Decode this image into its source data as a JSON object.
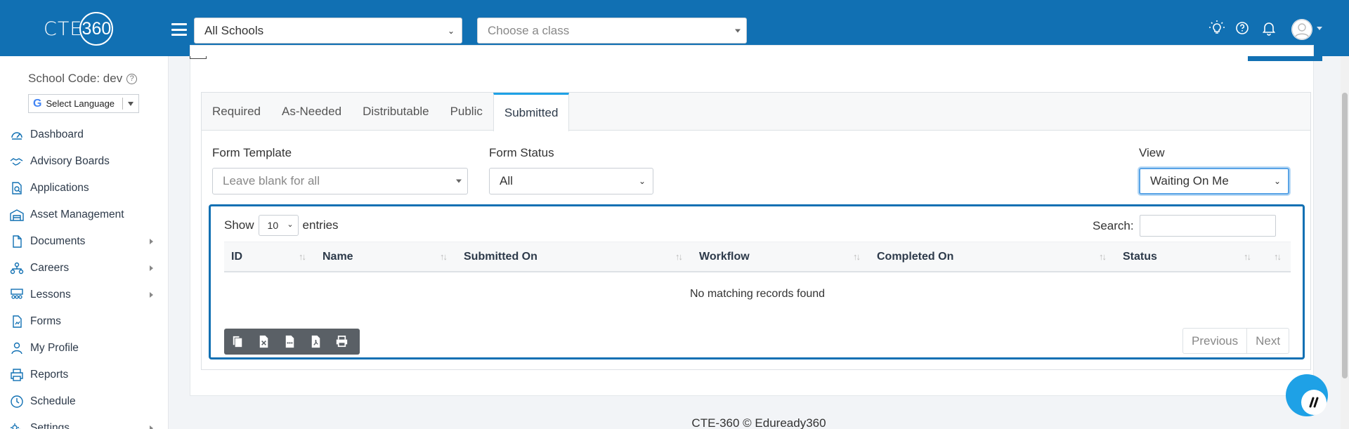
{
  "header": {
    "logo_text": "CTE",
    "logo_number": "360",
    "school_select": "All Schools",
    "class_select_placeholder": "Choose a class",
    "icons": [
      "lightbulb-icon",
      "help-circle-icon",
      "bell-icon",
      "user-avatar-icon"
    ]
  },
  "sidebar": {
    "school_code": "School Code: dev",
    "language_label": "Select Language",
    "items": [
      {
        "label": "Dashboard",
        "icon": "dashboard-icon",
        "submenu": false
      },
      {
        "label": "Advisory Boards",
        "icon": "handshake-icon",
        "submenu": false
      },
      {
        "label": "Applications",
        "icon": "document-search-icon",
        "submenu": false
      },
      {
        "label": "Asset Management",
        "icon": "warehouse-icon",
        "submenu": false
      },
      {
        "label": "Documents",
        "icon": "file-icon",
        "submenu": true
      },
      {
        "label": "Careers",
        "icon": "org-chart-icon",
        "submenu": true
      },
      {
        "label": "Lessons",
        "icon": "classroom-icon",
        "submenu": true
      },
      {
        "label": "Forms",
        "icon": "form-icon",
        "submenu": false
      },
      {
        "label": "My Profile",
        "icon": "user-icon",
        "submenu": false
      },
      {
        "label": "Reports",
        "icon": "printer-icon",
        "submenu": false
      },
      {
        "label": "Schedule",
        "icon": "clock-icon",
        "submenu": false
      },
      {
        "label": "Settings",
        "icon": "settings-icon",
        "submenu": true
      }
    ]
  },
  "tabs": [
    {
      "label": "Required",
      "active": false
    },
    {
      "label": "As-Needed",
      "active": false
    },
    {
      "label": "Distributable",
      "active": false
    },
    {
      "label": "Public",
      "active": false
    },
    {
      "label": "Submitted",
      "active": true
    }
  ],
  "filters": {
    "form_template_label": "Form Template",
    "form_template_placeholder": "Leave blank for all",
    "form_status_label": "Form Status",
    "form_status_value": "All",
    "view_label": "View",
    "view_value": "Waiting On Me"
  },
  "table": {
    "show_label": "Show",
    "entries_value": "10",
    "entries_label": "entries",
    "search_label": "Search:",
    "columns": [
      "ID",
      "Name",
      "Submitted On",
      "Workflow",
      "Completed On",
      "Status"
    ],
    "empty_message": "No matching records found",
    "export_buttons": [
      "copy-icon",
      "excel-icon",
      "csv-icon",
      "pdf-icon",
      "print-icon"
    ],
    "pager": {
      "previous": "Previous",
      "next": "Next"
    }
  },
  "footer": {
    "text": "CTE-360 © Eduready360"
  },
  "colors": {
    "brand": "#1170b3",
    "accent": "#1ea1e6",
    "button_group": "#5a6066"
  }
}
